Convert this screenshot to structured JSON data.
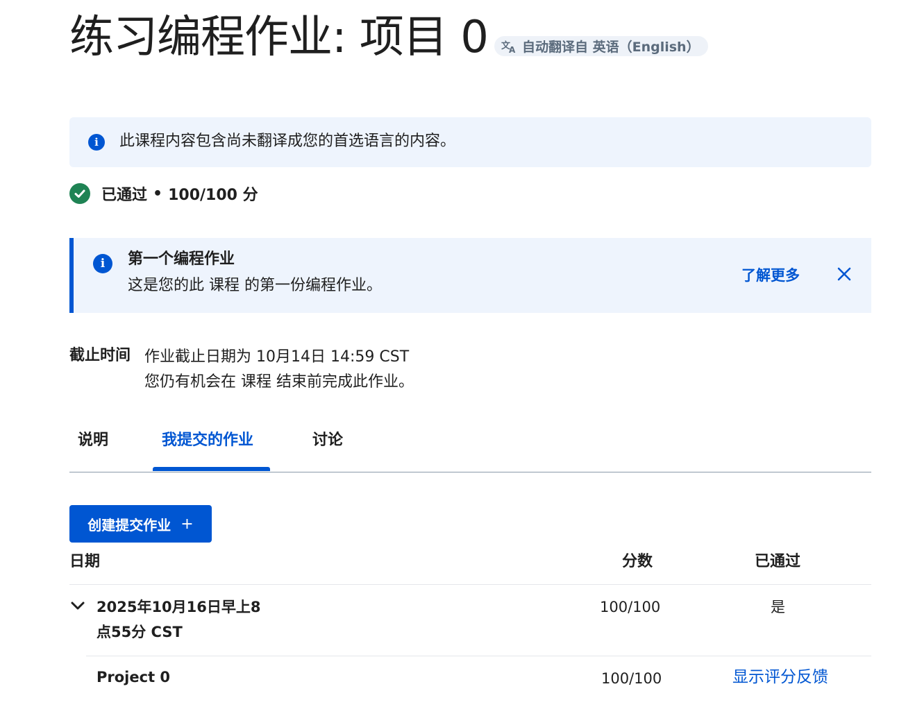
{
  "header": {
    "title": "练习编程作业: 项目 0",
    "translate_chip": "自动翻译自 英语（English）",
    "translate_icon": "translate-icon"
  },
  "banner_untranslated": {
    "icon": "info-icon",
    "message": "此课程内容包含尚未翻译成您的首选语言的内容。"
  },
  "status": {
    "icon": "check-circle-icon",
    "label": "已通过",
    "separator": "•",
    "score": "100/100 分",
    "color": "#1f8354"
  },
  "banner_first": {
    "icon": "info-icon",
    "title": "第一个编程作业",
    "text": "这是您的此 课程 的第一份编程作业。",
    "learn_more": "了解更多",
    "close_icon": "close-icon"
  },
  "deadline": {
    "label": "截止时间",
    "line1": "作业截止日期为 10月14日 14:59 CST",
    "line2": "您仍有机会在 课程 结束前完成此作业。"
  },
  "tabs": [
    {
      "label": "说明",
      "active": false
    },
    {
      "label": "我提交的作业",
      "active": true
    },
    {
      "label": "讨论",
      "active": false
    }
  ],
  "create_button": {
    "label": "创建提交作业",
    "icon": "+"
  },
  "table": {
    "headers": {
      "date": "日期",
      "score": "分数",
      "passed": "已通过"
    },
    "rows": [
      {
        "date_line1": "2025年10月16日早上8",
        "date_line2": "点55分 CST",
        "score": "100/100",
        "passed": "是",
        "expand_icon": "chevron-down-icon",
        "sub": {
          "name": "Project 0",
          "score": "100/100",
          "feedback_link": "显示评分反馈"
        }
      }
    ]
  },
  "colors": {
    "accent": "#0056d2",
    "banner_bg": "#eef4fd",
    "success": "#1f8354"
  }
}
